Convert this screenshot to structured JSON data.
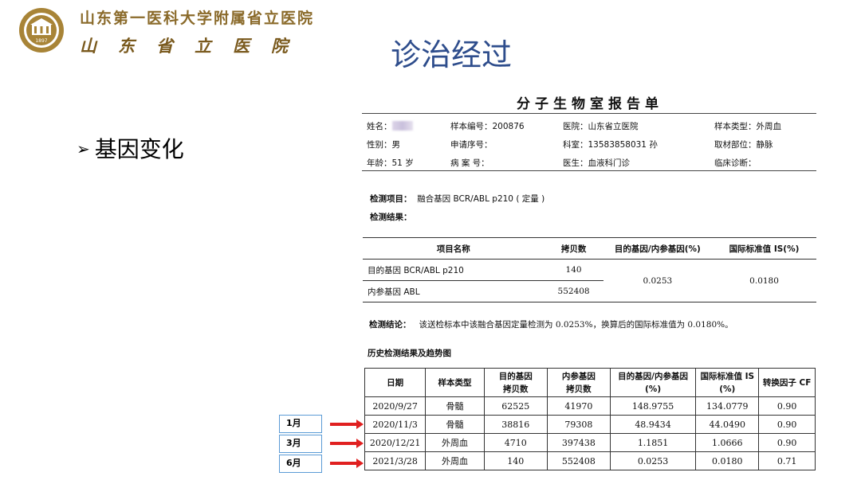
{
  "header": {
    "hospital_name_line1": "山东第一医科大学附属省立医院",
    "hospital_name_line2": "山东省立医院",
    "logo_year": "1897",
    "logo_text": "SHANDONG PROVINCIAL HOSPITAL"
  },
  "slide_title": "诊治经过",
  "bullet": {
    "marker": "➢",
    "text": "基因变化"
  },
  "report": {
    "title": "分子生物室报告单",
    "info": {
      "name_label": "姓名：",
      "sample_no": "样本编号：200876",
      "hospital": "医院：山东省立医院",
      "sample_type": "样本类型：外周血",
      "sex": "性别：男",
      "apply_no": "申请序号：",
      "dept": "科室：13583858031 孙",
      "material": "取材部位：静脉",
      "age": "年龄：51 岁",
      "case_no": "病 案 号：",
      "doctor": "医生：血液科门诊",
      "diagnosis": "临床诊断："
    },
    "test_item_label": "检测项目：",
    "test_item_value": "融合基因 BCR/ABL p210 ( 定量 )",
    "test_result_label": "检测结果：",
    "result_table": {
      "headers": [
        "项目名称",
        "拷贝数",
        "目的基因/内参基因(%)",
        "国际标准值 IS(%)"
      ],
      "rows": [
        {
          "name": "目的基因 BCR/ABL p210",
          "copies": "140"
        },
        {
          "name": "内参基因 ABL",
          "copies": "552408"
        }
      ],
      "ratio": "0.0253",
      "is_value": "0.0180"
    },
    "conclusion_label": "检测结论：",
    "conclusion_text": "该送检标本中该融合基因定量检测为 0.0253%，换算后的国际标准值为 0.0180%。",
    "history_title": "历史检测结果及趋势图",
    "history_table": {
      "headers": [
        {
          "l1": "日期",
          "l2": ""
        },
        {
          "l1": "样本类型",
          "l2": ""
        },
        {
          "l1": "目的基因",
          "l2": "拷贝数"
        },
        {
          "l1": "内参基因",
          "l2": "拷贝数"
        },
        {
          "l1": "目的基因/内参基因",
          "l2": "(%)"
        },
        {
          "l1": "国际标准值 IS",
          "l2": "(%)"
        },
        {
          "l1": "转换因子 CF",
          "l2": ""
        }
      ],
      "rows": [
        [
          "2020/9/27",
          "骨髓",
          "62525",
          "41970",
          "148.9755",
          "134.0779",
          "0.90"
        ],
        [
          "2020/11/3",
          "骨髓",
          "38816",
          "79308",
          "48.9434",
          "44.0490",
          "0.90"
        ],
        [
          "2020/12/21",
          "外周血",
          "4710",
          "397438",
          "1.1851",
          "1.0666",
          "0.90"
        ],
        [
          "2021/3/28",
          "外周血",
          "140",
          "552408",
          "0.0253",
          "0.0180",
          "0.71"
        ]
      ]
    }
  },
  "markers": [
    "1月",
    "3月",
    "6月"
  ],
  "colors": {
    "title_blue": "#2e4d8c",
    "gold": "#8a6a2a",
    "arrow_red": "#e02020",
    "box_blue": "#5b9bd5"
  }
}
